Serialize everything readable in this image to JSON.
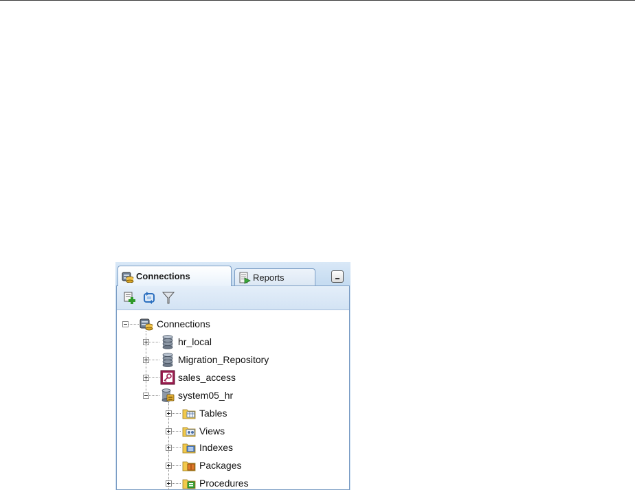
{
  "panel": {
    "tabs": [
      {
        "label": "Connections",
        "icon": "connections-icon",
        "active": true
      },
      {
        "label": "Reports",
        "icon": "reports-icon",
        "active": false
      }
    ],
    "minimize": "minimize-icon",
    "toolbar": [
      {
        "icon": "new-connection-icon"
      },
      {
        "icon": "refresh-icon"
      },
      {
        "icon": "filter-icon"
      }
    ]
  },
  "tree": {
    "root": {
      "label": "Connections",
      "expanded": true
    },
    "connections": [
      {
        "label": "hr_local",
        "icon": "database-icon",
        "expanded": false
      },
      {
        "label": "Migration_Repository",
        "icon": "database-icon",
        "expanded": false
      },
      {
        "label": "sales_access",
        "icon": "access-key-icon",
        "expanded": false
      },
      {
        "label": "system05_hr",
        "icon": "connected-database-icon",
        "expanded": true
      }
    ],
    "children": [
      {
        "label": "Tables",
        "icon": "tables-folder-icon"
      },
      {
        "label": "Views",
        "icon": "views-folder-icon"
      },
      {
        "label": "Indexes",
        "icon": "indexes-folder-icon"
      },
      {
        "label": "Packages",
        "icon": "packages-folder-icon"
      },
      {
        "label": "Procedures",
        "icon": "procedures-folder-icon"
      }
    ]
  },
  "colors": {
    "panel_bg": "#c6dcf1",
    "border": "#7a9cc4",
    "accent_green": "#2f9a2a"
  }
}
